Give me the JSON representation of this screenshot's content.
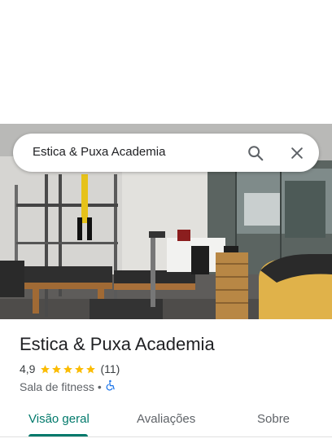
{
  "search": {
    "query": "Estica & Puxa Academia"
  },
  "place": {
    "name": "Estica & Puxa Academia",
    "rating": "4,9",
    "stars": 5,
    "review_count": "(11)",
    "category": "Sala de fitness",
    "separator": "•"
  },
  "tabs": [
    {
      "label": "Visão geral",
      "active": true
    },
    {
      "label": "Avaliações",
      "active": false
    },
    {
      "label": "Sobre",
      "active": false
    }
  ],
  "colors": {
    "accent": "#00796b",
    "star": "#fbbc04",
    "accessibility": "#1a73e8"
  },
  "icons": {
    "search": "search-icon",
    "close": "close-icon",
    "accessibility": "wheelchair-icon"
  }
}
